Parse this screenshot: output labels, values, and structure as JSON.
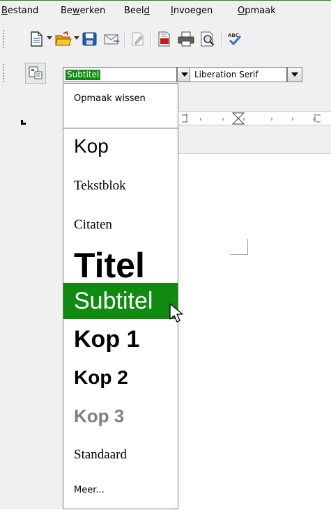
{
  "menubar": {
    "items": [
      {
        "pre": "",
        "acc": "B",
        "post": "estand"
      },
      {
        "pre": "Be",
        "acc": "w",
        "post": "erken"
      },
      {
        "pre": "Beel",
        "acc": "d",
        "post": ""
      },
      {
        "pre": "",
        "acc": "I",
        "post": "nvoegen"
      },
      {
        "pre": "",
        "acc": "O",
        "post": "pmaak"
      }
    ]
  },
  "toolbar": {
    "icons": [
      "new-document-icon",
      "open-folder-icon",
      "save-icon",
      "email-icon",
      "edit-document-icon",
      "export-pdf-icon",
      "print-icon",
      "print-preview-icon",
      "spellcheck-icon"
    ],
    "spellcheck_label": "ABC"
  },
  "formatting": {
    "style_value": "Subtitel",
    "font_value": "Liberation Serif"
  },
  "style_list": {
    "clear": "Opmaak wissen",
    "items": [
      "Kop",
      "Tekstblok",
      "Citaten",
      "Titel",
      "Subtitel",
      "Kop 1",
      "Kop 2",
      "Kop 3",
      "Standaard"
    ],
    "more": "Meer...",
    "selected": "Subtitel"
  },
  "colors": {
    "selection": "#108a10",
    "kop3_gray": "#808080"
  }
}
